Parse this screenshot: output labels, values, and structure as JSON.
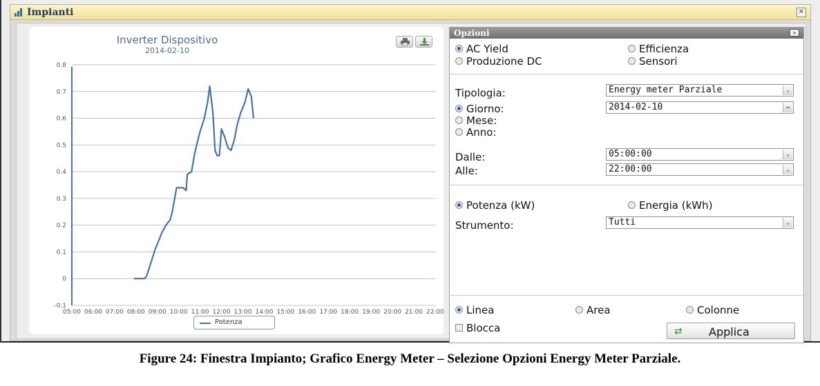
{
  "window": {
    "title": "Impianti",
    "close_glyph": "✕"
  },
  "chart_data": {
    "type": "line",
    "title": "Inverter Dispositivo",
    "subtitle": "2014-02-10",
    "ylim": [
      -0.1,
      0.8
    ],
    "yticks": [
      "-0.1",
      "0",
      "0.1",
      "0.2",
      "0.3",
      "0.4",
      "0.5",
      "0.6",
      "0.7",
      "0.8"
    ],
    "xticks": [
      "05:00",
      "06:00",
      "07:00",
      "08:00",
      "09:00",
      "10:00",
      "11:00",
      "12:00",
      "13:00",
      "14:00",
      "15:00",
      "16:00",
      "17:00",
      "18:00",
      "19:00",
      "20:00",
      "21:00",
      "22:00"
    ],
    "xlim": [
      5,
      22
    ],
    "series": [
      {
        "name": "Potenza",
        "color": "#4572a7",
        "x": [
          7.9,
          8.2,
          8.4,
          8.5,
          8.7,
          8.9,
          9.1,
          9.2,
          9.4,
          9.6,
          9.7,
          9.9,
          10.2,
          10.35,
          10.4,
          10.6,
          10.75,
          10.9,
          11.0,
          11.2,
          11.35,
          11.45,
          11.6,
          11.7,
          11.8,
          11.9,
          12.0,
          12.15,
          12.3,
          12.45,
          12.6,
          12.75,
          12.9,
          13.1,
          13.25,
          13.4,
          13.5
        ],
        "y": [
          0.0,
          0.0,
          0.0,
          0.01,
          0.06,
          0.11,
          0.15,
          0.17,
          0.2,
          0.22,
          0.25,
          0.34,
          0.34,
          0.33,
          0.39,
          0.4,
          0.47,
          0.52,
          0.55,
          0.6,
          0.66,
          0.72,
          0.62,
          0.48,
          0.46,
          0.46,
          0.56,
          0.53,
          0.49,
          0.48,
          0.52,
          0.58,
          0.62,
          0.66,
          0.71,
          0.68,
          0.6
        ]
      }
    ]
  },
  "chart": {
    "legend_label": "Potenza"
  },
  "options": {
    "header": "Opzioni",
    "collapse_glyph": "»",
    "mode": {
      "ac_yield": "AC Yield",
      "efficienza": "Efficienza",
      "produzione_dc": "Produzione DC",
      "sensori": "Sensori"
    },
    "tipologia_label": "Tipologia:",
    "tipologia_value": "Energy meter Parziale",
    "giorno_label": "Giorno:",
    "giorno_value": "2014-02-10",
    "mese_label": "Mese:",
    "anno_label": "Anno:",
    "dalle_label": "Dalle:",
    "dalle_value": "05:00:00",
    "alle_label": "Alle:",
    "alle_value": "22:00:00",
    "potenza_label": "Potenza (kW)",
    "energia_label": "Energia (kWh)",
    "strumento_label": "Strumento:",
    "strumento_value": "Tutti",
    "linea_label": "Linea",
    "area_label": "Area",
    "colonne_label": "Colonne",
    "blocca_label": "Blocca",
    "applica_label": "Applica"
  },
  "caption": "Figure 24: Finestra Impianto; Grafico Energy Meter – Selezione Opzioni Energy Meter Parziale."
}
